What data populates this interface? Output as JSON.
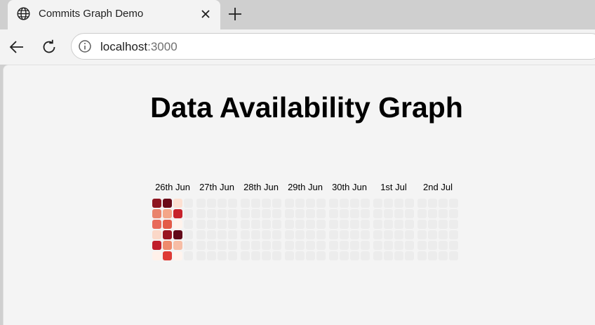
{
  "browser": {
    "tab_title": "Commits Graph Demo",
    "url_host": "localhost",
    "url_port": ":3000"
  },
  "page": {
    "title": "Data Availability Graph"
  },
  "graph": {
    "dates": [
      "26th Jun",
      "27th Jun",
      "28th Jun",
      "29th Jun",
      "30th Jun",
      "1st Jul",
      "2nd Jul"
    ],
    "columns_per_day": 4,
    "rows": 6,
    "empty_color": "#ececec",
    "cells": [
      {
        "col": 0,
        "row": 0,
        "color": "#8e1520"
      },
      {
        "col": 0,
        "row": 1,
        "color": "#e9836c"
      },
      {
        "col": 0,
        "row": 2,
        "color": "#e8695a"
      },
      {
        "col": 0,
        "row": 3,
        "color": "#fbd8c8"
      },
      {
        "col": 0,
        "row": 4,
        "color": "#c01e2b"
      },
      {
        "col": 0,
        "row": 5,
        "color": "#fff1ea"
      },
      {
        "col": 1,
        "row": 0,
        "color": "#6a0a18"
      },
      {
        "col": 1,
        "row": 1,
        "color": "#f4a688"
      },
      {
        "col": 1,
        "row": 2,
        "color": "#e35b48"
      },
      {
        "col": 1,
        "row": 3,
        "color": "#9a1421"
      },
      {
        "col": 1,
        "row": 4,
        "color": "#ee8a6c"
      },
      {
        "col": 1,
        "row": 5,
        "color": "#de3a35"
      },
      {
        "col": 2,
        "row": 0,
        "color": "#fde0d2"
      },
      {
        "col": 2,
        "row": 1,
        "color": "#c7232c"
      },
      {
        "col": 2,
        "row": 2,
        "color": "#fff3ec"
      },
      {
        "col": 2,
        "row": 3,
        "color": "#63091a"
      },
      {
        "col": 2,
        "row": 4,
        "color": "#f7bda5"
      },
      {
        "col": 2,
        "row": 5,
        "color": "#fff4ee"
      }
    ]
  }
}
